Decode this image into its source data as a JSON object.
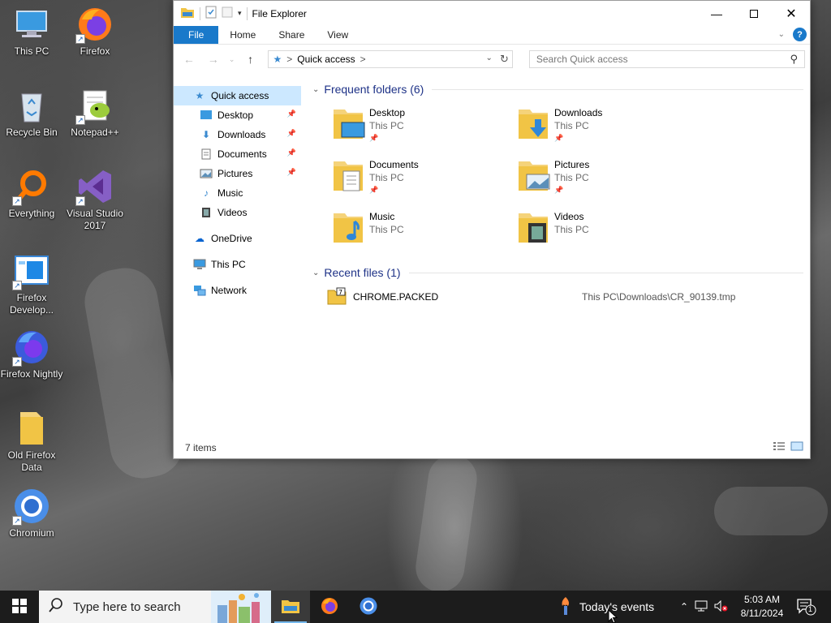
{
  "desktop": {
    "icons": [
      {
        "label": "This PC"
      },
      {
        "label": "Firefox"
      },
      {
        "label": "Recycle Bin"
      },
      {
        "label": "Notepad++"
      },
      {
        "label": "Everything"
      },
      {
        "label": "Visual Studio 2017"
      },
      {
        "label": "Firefox Develop..."
      },
      {
        "label": "Firefox Nightly"
      },
      {
        "label": "Old Firefox Data"
      },
      {
        "label": "Chromium"
      }
    ]
  },
  "explorer": {
    "title": "File Explorer",
    "tabs": {
      "file": "File",
      "home": "Home",
      "share": "Share",
      "view": "View"
    },
    "address": {
      "root_separator": ">",
      "location": "Quick access",
      "trailing_separator": ">"
    },
    "search": {
      "placeholder": "Search Quick access"
    },
    "help_label": "?",
    "sidebar": {
      "quick_access": "Quick access",
      "pinned": [
        {
          "label": "Desktop"
        },
        {
          "label": "Downloads"
        },
        {
          "label": "Documents"
        },
        {
          "label": "Pictures"
        }
      ],
      "recent": [
        {
          "label": "Music"
        },
        {
          "label": "Videos"
        }
      ],
      "onedrive": "OneDrive",
      "this_pc": "This PC",
      "network": "Network"
    },
    "frequent": {
      "header": "Frequent folders (6)",
      "folders": [
        {
          "name": "Desktop",
          "location": "This PC"
        },
        {
          "name": "Downloads",
          "location": "This PC"
        },
        {
          "name": "Documents",
          "location": "This PC"
        },
        {
          "name": "Pictures",
          "location": "This PC"
        },
        {
          "name": "Music",
          "location": "This PC"
        },
        {
          "name": "Videos",
          "location": "This PC"
        }
      ]
    },
    "recent_files": {
      "header": "Recent files (1)",
      "files": [
        {
          "name": "CHROME.PACKED",
          "path": "This PC\\Downloads\\CR_90139.tmp"
        }
      ]
    },
    "status": {
      "item_count": "7 items"
    }
  },
  "taskbar": {
    "search_placeholder": "Type here to search",
    "events_label": "Today's events",
    "clock": {
      "time": "5:03 AM",
      "date": "8/11/2024"
    },
    "notification_count": "1"
  },
  "colors": {
    "accent": "#1979ca",
    "selected": "#cce8ff",
    "group_header": "#1e3287",
    "folder": "#f5c957"
  }
}
